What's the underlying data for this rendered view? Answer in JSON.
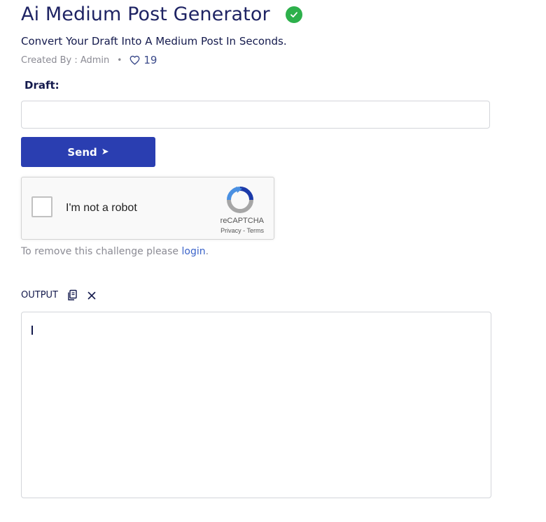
{
  "header": {
    "title": "Ai Medium Post Generator",
    "subtitle": "Convert Your Draft Into A Medium Post In Seconds.",
    "created_by": "Created By : Admin",
    "separator": "•",
    "likes": "19"
  },
  "form": {
    "draft_label": "Draft:",
    "draft_value": "",
    "send_label": "Send",
    "send_arrow": "➤"
  },
  "captcha": {
    "label": "I'm not a robot",
    "brand": "reCAPTCHA",
    "privacy": "Privacy",
    "terms_sep": " - ",
    "terms": "Terms"
  },
  "notice": {
    "text": "To remove this challenge please ",
    "link": "login",
    "suffix": "."
  },
  "output": {
    "label": "OUTPUT",
    "value": ""
  },
  "colors": {
    "primary": "#2a3eb1",
    "verified": "#2db04b",
    "link": "#3b63c9"
  },
  "icons": [
    "verified-check-icon",
    "heart-icon",
    "send-arrow-icon",
    "recaptcha-icon",
    "copy-icon",
    "clear-icon"
  ]
}
